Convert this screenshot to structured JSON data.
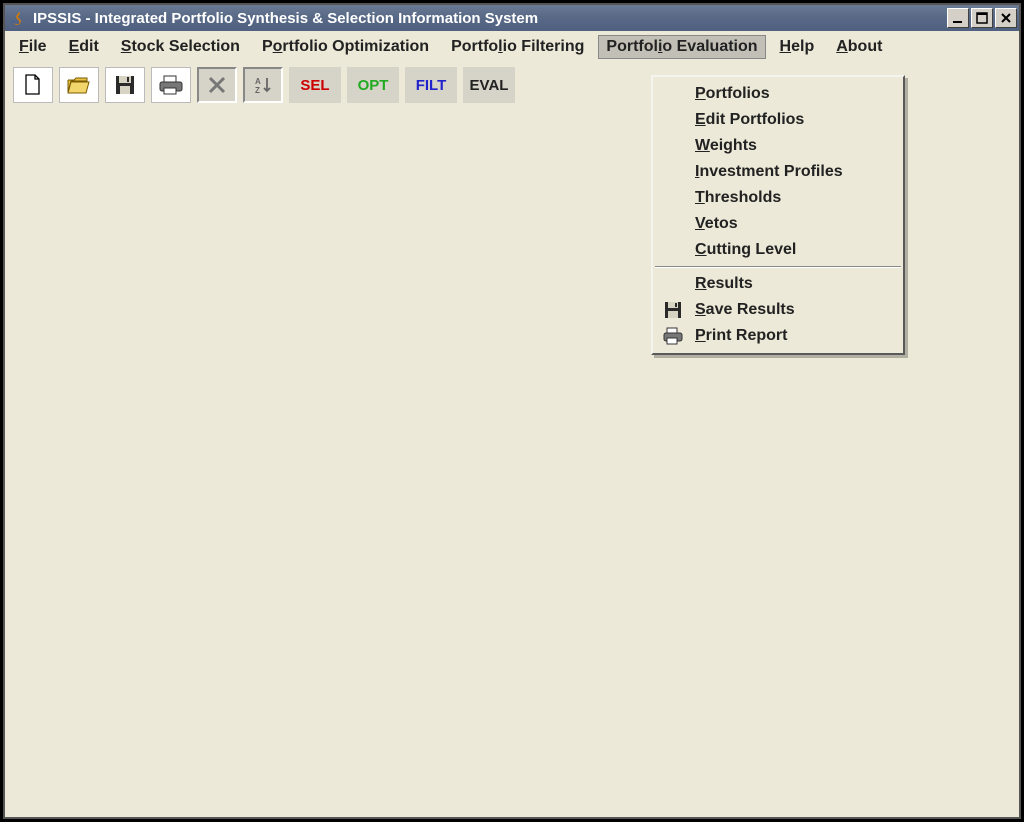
{
  "window": {
    "title": "IPSSIS - Integrated Portfolio Synthesis & Selection Information System"
  },
  "menubar": {
    "items": [
      {
        "u": "F",
        "rest": "ile"
      },
      {
        "u": "E",
        "rest": "dit"
      },
      {
        "u": "S",
        "rest": "tock Selection"
      },
      {
        "pre": "P",
        "u": "o",
        "rest": "rtfolio Optimization"
      },
      {
        "pre": "Portfo",
        "u": "l",
        "rest": "io Filtering"
      },
      {
        "pre": "Portfol",
        "u": "i",
        "rest": "o Evaluation"
      },
      {
        "u": "H",
        "rest": "elp"
      },
      {
        "u": "A",
        "rest": "bout"
      }
    ],
    "active_index": 5
  },
  "toolbar": {
    "new_label": "new",
    "open_label": "open",
    "save_label": "save",
    "print_label": "print",
    "sel": "SEL",
    "opt": "OPT",
    "filt": "FILT",
    "eval": "EVAL"
  },
  "dropdown": {
    "items": [
      {
        "u": "P",
        "rest": "ortfolios",
        "icon": ""
      },
      {
        "u": "E",
        "rest": "dit Portfolios",
        "icon": ""
      },
      {
        "u": "W",
        "rest": "eights",
        "icon": ""
      },
      {
        "u": "I",
        "rest": "nvestment Profiles",
        "icon": ""
      },
      {
        "u": "T",
        "rest": "hresholds",
        "icon": ""
      },
      {
        "u": "V",
        "rest": "etos",
        "icon": ""
      },
      {
        "u": "C",
        "rest": "utting Level",
        "icon": ""
      }
    ],
    "items2": [
      {
        "u": "R",
        "rest": "esults",
        "icon": ""
      },
      {
        "u": "S",
        "rest": "ave Results",
        "icon": "save"
      },
      {
        "u": "P",
        "rest": "rint Report",
        "icon": "print"
      }
    ]
  }
}
